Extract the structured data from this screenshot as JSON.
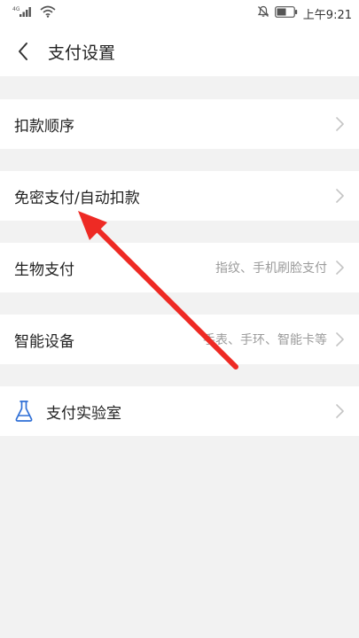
{
  "status_bar": {
    "network_tag": "4G",
    "time": "上午9:21"
  },
  "header": {
    "title": "支付设置"
  },
  "rows": [
    {
      "label": "扣款顺序",
      "value": ""
    },
    {
      "label": "免密支付/自动扣款",
      "value": ""
    },
    {
      "label": "生物支付",
      "value": "指纹、手机刷脸支付"
    },
    {
      "label": "智能设备",
      "value": "手表、手环、智能卡等"
    },
    {
      "label": "支付实验室",
      "value": ""
    }
  ],
  "colors": {
    "annotation_arrow": "#ee2a24",
    "lab_icon": "#2f6fd6",
    "chevron": "#c4c4c4"
  }
}
